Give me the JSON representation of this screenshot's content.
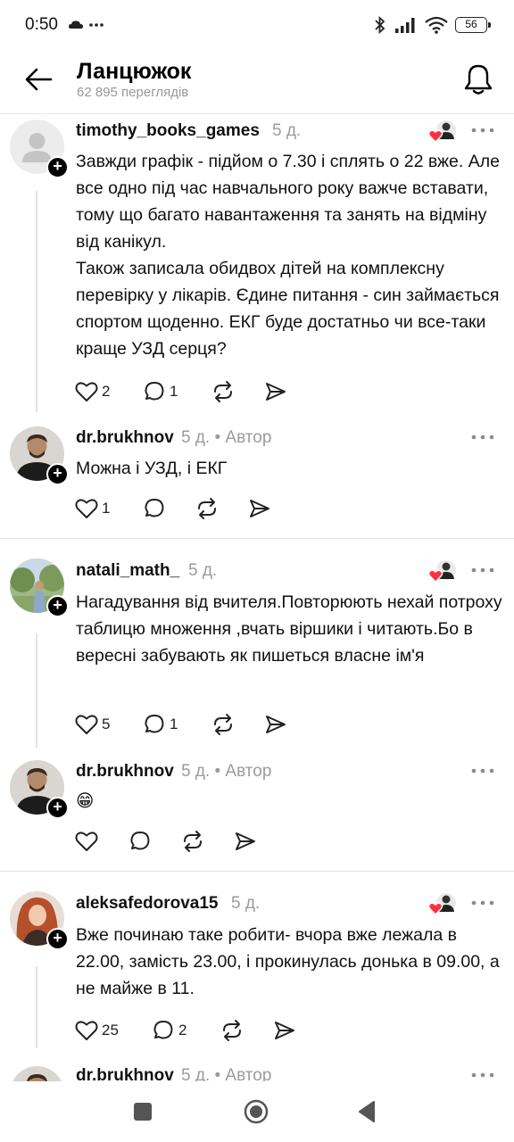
{
  "status_bar": {
    "time": "0:50",
    "left_icons": [
      "cloud-icon",
      "more-icon"
    ],
    "right_icons": [
      "bluetooth-icon",
      "signal-icon",
      "wifi-icon",
      "battery-icon"
    ],
    "battery": "56"
  },
  "header": {
    "title": "Ланцюжок",
    "views": "62 895 переглядів"
  },
  "posts": [
    {
      "username": "timothy_books_games",
      "time": "5 д.",
      "author_tag": "",
      "text": "Завжди графік - підйом о 7.30 і сплять о 22 вже. Але все одно під час навчального року важче вставати, тому що багато навантаження та занять на відміну від канікул.\nТакож записала обидвох дітей на комплексну перевірку у лікарів. Єдине питання - син займається спортом щоденно. ЕКГ буде достатньо чи все-таки краще УЗД серця?",
      "likes": "2",
      "replies": "1"
    },
    {
      "username": "dr.brukhnov",
      "time": "5 д.",
      "author_tag": "• Автор",
      "text": "Можна і УЗД, і ЕКГ",
      "likes": "1",
      "replies": ""
    },
    {
      "username": "natali_math_",
      "time": "5 д.",
      "author_tag": "",
      "text": "Нагадування від вчителя.Повторюють нехай потроху таблицю множення ,вчать віршики і читають.Бо в вересні забувають як пишеться власне ім'я",
      "likes": "5",
      "replies": "1"
    },
    {
      "username": "dr.brukhnov",
      "time": "5 д.",
      "author_tag": "• Автор",
      "text": "😁",
      "likes": "",
      "replies": ""
    },
    {
      "username": "aleksafedorova15",
      "time": "5 д.",
      "author_tag": "",
      "text": "Вже починаю таке робити- вчора вже лежала в 22.00, замість 23.00, і прокинулась донька в 09.00, а не майже в 11.",
      "likes": "25",
      "replies": "2"
    },
    {
      "username": "dr.brukhnov",
      "time": "5 д.",
      "author_tag": "• Автор",
      "text": "",
      "likes": "",
      "replies": ""
    }
  ],
  "colors": {
    "text": "#111111",
    "muted": "#9b9b9b",
    "divider": "#e6e6e6",
    "like_heart": "#ff3040"
  },
  "nav": {
    "icons": [
      "recents-square-icon",
      "home-circle-icon",
      "back-triangle-icon"
    ]
  }
}
